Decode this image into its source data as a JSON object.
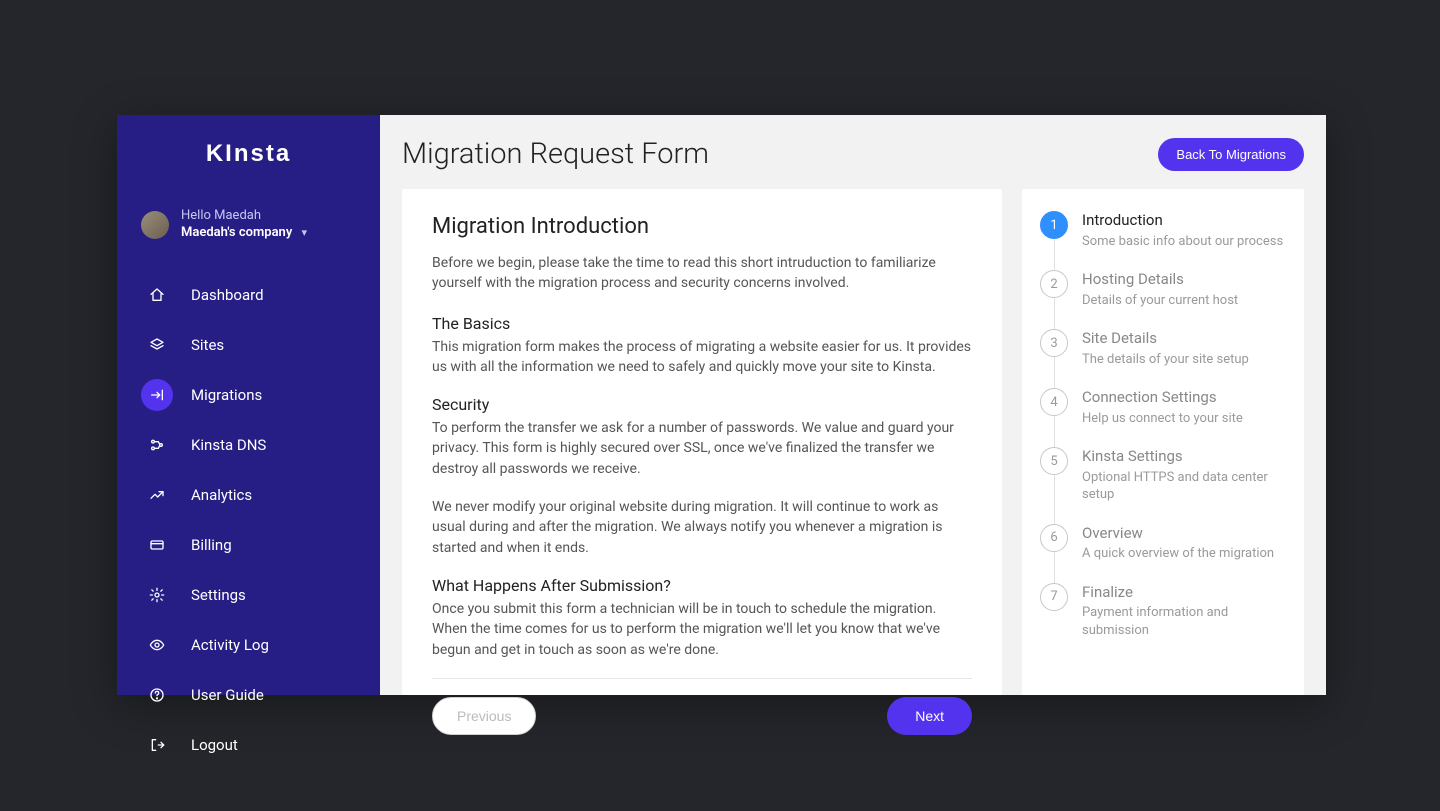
{
  "brand": "KInsta",
  "user": {
    "greeting": "Hello Maedah",
    "company": "Maedah's company"
  },
  "sidebar": {
    "items": [
      {
        "id": "dashboard",
        "label": "Dashboard",
        "icon": "home-icon",
        "active": false
      },
      {
        "id": "sites",
        "label": "Sites",
        "icon": "layers-icon",
        "active": false
      },
      {
        "id": "migrations",
        "label": "Migrations",
        "icon": "migrate-icon",
        "active": true
      },
      {
        "id": "kinsta-dns",
        "label": "Kinsta DNS",
        "icon": "dns-icon",
        "active": false
      },
      {
        "id": "analytics",
        "label": "Analytics",
        "icon": "chart-icon",
        "active": false
      },
      {
        "id": "billing",
        "label": "Billing",
        "icon": "card-icon",
        "active": false
      },
      {
        "id": "settings",
        "label": "Settings",
        "icon": "gear-icon",
        "active": false
      },
      {
        "id": "activity-log",
        "label": "Activity Log",
        "icon": "eye-icon",
        "active": false
      },
      {
        "id": "user-guide",
        "label": "User Guide",
        "icon": "help-icon",
        "active": false
      },
      {
        "id": "logout",
        "label": "Logout",
        "icon": "logout-icon",
        "active": false
      }
    ]
  },
  "header": {
    "title": "Migration Request Form",
    "back_button": "Back To Migrations"
  },
  "content": {
    "title": "Migration Introduction",
    "intro": "Before we begin, please take the time to read this short intruduction to familiarize yourself with the migration process and security concerns involved.",
    "sections": [
      {
        "heading": "The Basics",
        "body": "This migration form makes the process of migrating a website easier for us. It provides us with all the information we need to safely and quickly move your site to Kinsta."
      },
      {
        "heading": "Security",
        "body": "To perform the transfer we ask for a number of passwords. We value and guard your privacy. This form is highly secured over SSL, once we've finalized the transfer we destroy all passwords we receive."
      },
      {
        "heading": "",
        "body": "We never modify your original website during migration. It will continue to work as usual during and after the migration. We always notify you whenever a migration is started and when it ends."
      },
      {
        "heading": "What Happens After Submission?",
        "body": "Once you submit this form a technician will be in touch to schedule the migration. When the time comes for us to perform the migration we'll let you know that we've begun and get in touch as soon as we're done."
      }
    ],
    "prev_label": "Previous",
    "next_label": "Next"
  },
  "steps": [
    {
      "n": "1",
      "title": "Introduction",
      "desc": "Some basic info about our process",
      "active": true
    },
    {
      "n": "2",
      "title": "Hosting Details",
      "desc": "Details of your current host",
      "active": false
    },
    {
      "n": "3",
      "title": "Site Details",
      "desc": "The details of your site setup",
      "active": false
    },
    {
      "n": "4",
      "title": "Connection Settings",
      "desc": "Help us connect to your site",
      "active": false
    },
    {
      "n": "5",
      "title": "Kinsta Settings",
      "desc": "Optional HTTPS and data center setup",
      "active": false
    },
    {
      "n": "6",
      "title": "Overview",
      "desc": "A quick overview of the migration",
      "active": false
    },
    {
      "n": "7",
      "title": "Finalize",
      "desc": "Payment information and submission",
      "active": false
    }
  ]
}
